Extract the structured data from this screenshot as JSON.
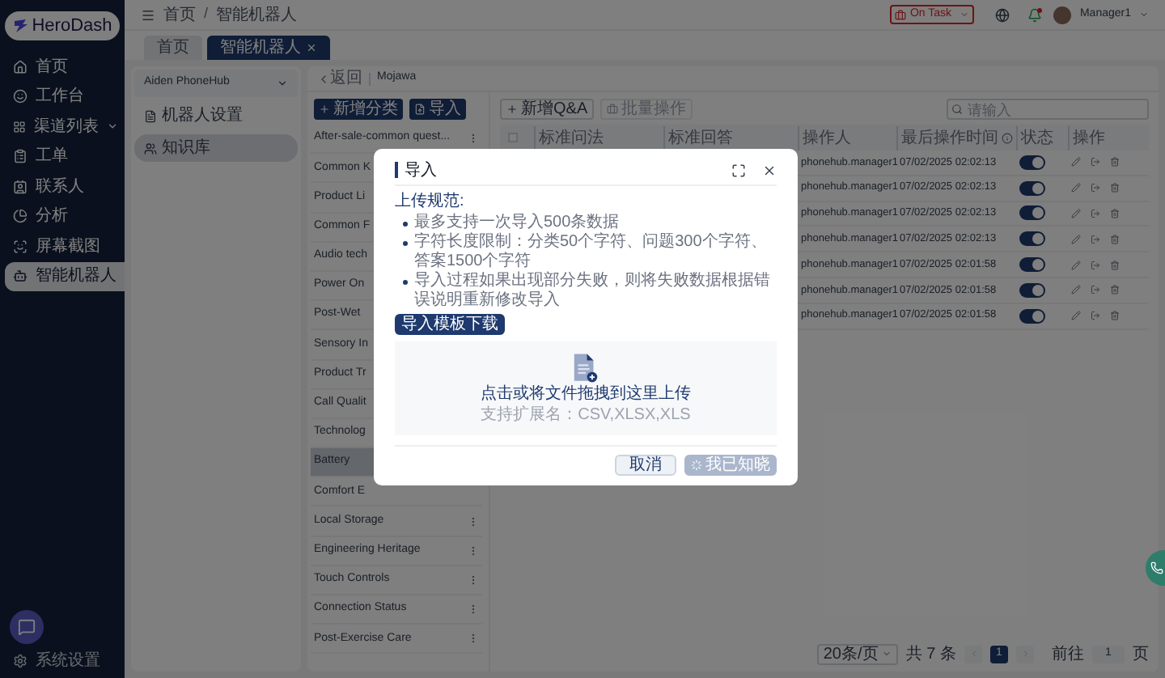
{
  "sidebar": {
    "logo": "HeroDash",
    "items": [
      {
        "label": "首页",
        "selected": false,
        "expandable": false
      },
      {
        "label": "工作台",
        "selected": false,
        "expandable": false
      },
      {
        "label": "渠道列表",
        "selected": false,
        "expandable": true
      },
      {
        "label": "工单",
        "selected": false,
        "expandable": false
      },
      {
        "label": "联系人",
        "selected": false,
        "expandable": false
      },
      {
        "label": "分析",
        "selected": false,
        "expandable": false
      },
      {
        "label": "屏幕截图",
        "selected": false,
        "expandable": false
      },
      {
        "label": "智能机器人",
        "selected": true,
        "expandable": false
      }
    ],
    "settings": "系统设置"
  },
  "topbar": {
    "breadcrumb": [
      "首页",
      "智能机器人"
    ],
    "separator": "/",
    "status": "On Task",
    "user": "Manager1"
  },
  "tabs": [
    {
      "label": "首页",
      "selected": false,
      "closable": false
    },
    {
      "label": "智能机器人",
      "selected": true,
      "closable": true
    }
  ],
  "bot_panel": {
    "select": "Aiden PhoneHub",
    "items": [
      {
        "label": "机器人设置",
        "selected": false
      },
      {
        "label": "知识库",
        "selected": true
      }
    ]
  },
  "header": {
    "back": "返回",
    "name": "Mojawa"
  },
  "categories": {
    "buttons": [
      "新增分类",
      "导入"
    ],
    "items": [
      {
        "label": "After-sale-common quest...",
        "selected": false,
        "has_menu": true
      },
      {
        "label": "Common K",
        "selected": false,
        "has_menu": false
      },
      {
        "label": "Product Li",
        "selected": false,
        "has_menu": false
      },
      {
        "label": "Common F",
        "selected": false,
        "has_menu": false
      },
      {
        "label": "Audio tech",
        "selected": false,
        "has_menu": false
      },
      {
        "label": "Power On",
        "selected": false,
        "has_menu": false
      },
      {
        "label": "Post-Wet",
        "selected": false,
        "has_menu": false
      },
      {
        "label": "Sensory In",
        "selected": false,
        "has_menu": false
      },
      {
        "label": "Product Tr",
        "selected": false,
        "has_menu": false
      },
      {
        "label": "Call Qualit",
        "selected": false,
        "has_menu": false
      },
      {
        "label": "Technolog",
        "selected": false,
        "has_menu": false
      },
      {
        "label": "Battery",
        "selected": true,
        "has_menu": false
      },
      {
        "label": "Comfort E",
        "selected": false,
        "has_menu": false
      },
      {
        "label": "Local Storage",
        "selected": false,
        "has_menu": true
      },
      {
        "label": "Engineering Heritage",
        "selected": false,
        "has_menu": true
      },
      {
        "label": "Touch Controls",
        "selected": false,
        "has_menu": true
      },
      {
        "label": "Connection Status",
        "selected": false,
        "has_menu": true
      },
      {
        "label": "Post-Exercise Care",
        "selected": false,
        "has_menu": true
      }
    ]
  },
  "table": {
    "add_button": "新增Q&A",
    "batch_button": {
      "label": "批量操作",
      "disabled": true
    },
    "search": {
      "placeholder": "请输入"
    },
    "select_all": {
      "checked": false
    },
    "columns": [
      "标准问法",
      "标准回答",
      "操作人",
      "最后操作时间",
      "状态",
      "操作"
    ],
    "rows": [
      {
        "operator": "phonehub.manager1",
        "time": "07/02/2025 02:02:13",
        "on": true
      },
      {
        "operator": "phonehub.manager1",
        "time": "07/02/2025 02:02:13",
        "on": true
      },
      {
        "operator": "phonehub.manager1",
        "time": "07/02/2025 02:02:13",
        "on": true
      },
      {
        "operator": "phonehub.manager1",
        "time": "07/02/2025 02:02:13",
        "on": true
      },
      {
        "operator": "phonehub.manager1",
        "time": "07/02/2025 02:01:58",
        "on": true
      },
      {
        "operator": "phonehub.manager1",
        "time": "07/02/2025 02:01:58",
        "on": true
      },
      {
        "operator": "phonehub.manager1",
        "time": "07/02/2025 02:01:58",
        "on": true
      }
    ],
    "pagination": {
      "page_size": "20条/页",
      "total": "共 7 条",
      "pages": [
        {
          "label": "1",
          "selected": true
        }
      ],
      "goto": "前往",
      "goto_value": "1",
      "page_unit": "页"
    }
  },
  "modal": {
    "title": "导入",
    "rules_title": "上传规范:",
    "rules": [
      "最多支持一次导入500条数据",
      "字符长度限制：分类50个字符、问题300个字符、答案1500个字符",
      "导入过程如果出现部分失败，则将失败数据根据错误说明重新修改导入"
    ],
    "template_button": "导入模板下载",
    "dropzone": {
      "text": "点击或将文件拖拽到这里上传",
      "hint": "支持扩展名：CSV,XLSX,XLS"
    },
    "cancel": "取消",
    "confirm": {
      "label": "我已知晓",
      "disabled": true
    }
  }
}
